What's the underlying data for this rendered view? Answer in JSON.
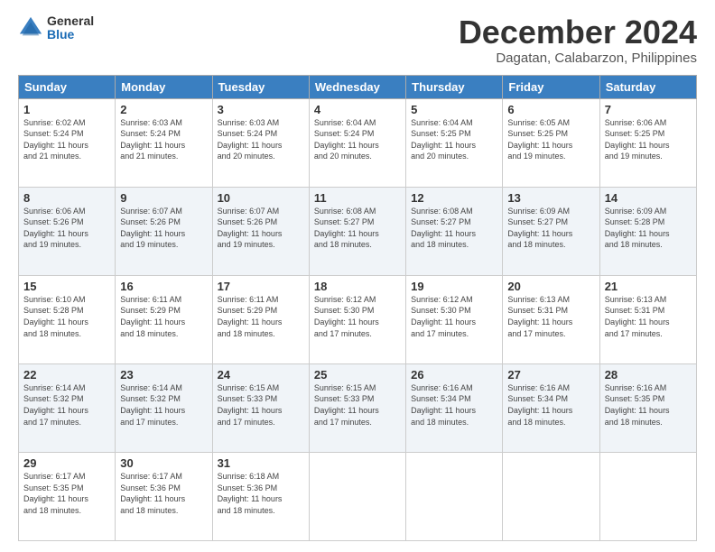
{
  "header": {
    "logo_general": "General",
    "logo_blue": "Blue",
    "month_title": "December 2024",
    "subtitle": "Dagatan, Calabarzon, Philippines"
  },
  "calendar": {
    "headers": [
      "Sunday",
      "Monday",
      "Tuesday",
      "Wednesday",
      "Thursday",
      "Friday",
      "Saturday"
    ],
    "weeks": [
      [
        {
          "day": "",
          "info": ""
        },
        {
          "day": "2",
          "info": "Sunrise: 6:03 AM\nSunset: 5:24 PM\nDaylight: 11 hours\nand 21 minutes."
        },
        {
          "day": "3",
          "info": "Sunrise: 6:03 AM\nSunset: 5:24 PM\nDaylight: 11 hours\nand 20 minutes."
        },
        {
          "day": "4",
          "info": "Sunrise: 6:04 AM\nSunset: 5:24 PM\nDaylight: 11 hours\nand 20 minutes."
        },
        {
          "day": "5",
          "info": "Sunrise: 6:04 AM\nSunset: 5:25 PM\nDaylight: 11 hours\nand 20 minutes."
        },
        {
          "day": "6",
          "info": "Sunrise: 6:05 AM\nSunset: 5:25 PM\nDaylight: 11 hours\nand 19 minutes."
        },
        {
          "day": "7",
          "info": "Sunrise: 6:06 AM\nSunset: 5:25 PM\nDaylight: 11 hours\nand 19 minutes."
        }
      ],
      [
        {
          "day": "1",
          "info": "Sunrise: 6:02 AM\nSunset: 5:24 PM\nDaylight: 11 hours\nand 21 minutes."
        },
        {
          "day": "",
          "info": ""
        },
        {
          "day": "",
          "info": ""
        },
        {
          "day": "",
          "info": ""
        },
        {
          "day": "",
          "info": ""
        },
        {
          "day": "",
          "info": ""
        },
        {
          "day": "",
          "info": ""
        }
      ],
      [
        {
          "day": "8",
          "info": "Sunrise: 6:06 AM\nSunset: 5:26 PM\nDaylight: 11 hours\nand 19 minutes."
        },
        {
          "day": "9",
          "info": "Sunrise: 6:07 AM\nSunset: 5:26 PM\nDaylight: 11 hours\nand 19 minutes."
        },
        {
          "day": "10",
          "info": "Sunrise: 6:07 AM\nSunset: 5:26 PM\nDaylight: 11 hours\nand 19 minutes."
        },
        {
          "day": "11",
          "info": "Sunrise: 6:08 AM\nSunset: 5:27 PM\nDaylight: 11 hours\nand 18 minutes."
        },
        {
          "day": "12",
          "info": "Sunrise: 6:08 AM\nSunset: 5:27 PM\nDaylight: 11 hours\nand 18 minutes."
        },
        {
          "day": "13",
          "info": "Sunrise: 6:09 AM\nSunset: 5:27 PM\nDaylight: 11 hours\nand 18 minutes."
        },
        {
          "day": "14",
          "info": "Sunrise: 6:09 AM\nSunset: 5:28 PM\nDaylight: 11 hours\nand 18 minutes."
        }
      ],
      [
        {
          "day": "15",
          "info": "Sunrise: 6:10 AM\nSunset: 5:28 PM\nDaylight: 11 hours\nand 18 minutes."
        },
        {
          "day": "16",
          "info": "Sunrise: 6:11 AM\nSunset: 5:29 PM\nDaylight: 11 hours\nand 18 minutes."
        },
        {
          "day": "17",
          "info": "Sunrise: 6:11 AM\nSunset: 5:29 PM\nDaylight: 11 hours\nand 18 minutes."
        },
        {
          "day": "18",
          "info": "Sunrise: 6:12 AM\nSunset: 5:30 PM\nDaylight: 11 hours\nand 17 minutes."
        },
        {
          "day": "19",
          "info": "Sunrise: 6:12 AM\nSunset: 5:30 PM\nDaylight: 11 hours\nand 17 minutes."
        },
        {
          "day": "20",
          "info": "Sunrise: 6:13 AM\nSunset: 5:31 PM\nDaylight: 11 hours\nand 17 minutes."
        },
        {
          "day": "21",
          "info": "Sunrise: 6:13 AM\nSunset: 5:31 PM\nDaylight: 11 hours\nand 17 minutes."
        }
      ],
      [
        {
          "day": "22",
          "info": "Sunrise: 6:14 AM\nSunset: 5:32 PM\nDaylight: 11 hours\nand 17 minutes."
        },
        {
          "day": "23",
          "info": "Sunrise: 6:14 AM\nSunset: 5:32 PM\nDaylight: 11 hours\nand 17 minutes."
        },
        {
          "day": "24",
          "info": "Sunrise: 6:15 AM\nSunset: 5:33 PM\nDaylight: 11 hours\nand 17 minutes."
        },
        {
          "day": "25",
          "info": "Sunrise: 6:15 AM\nSunset: 5:33 PM\nDaylight: 11 hours\nand 17 minutes."
        },
        {
          "day": "26",
          "info": "Sunrise: 6:16 AM\nSunset: 5:34 PM\nDaylight: 11 hours\nand 18 minutes."
        },
        {
          "day": "27",
          "info": "Sunrise: 6:16 AM\nSunset: 5:34 PM\nDaylight: 11 hours\nand 18 minutes."
        },
        {
          "day": "28",
          "info": "Sunrise: 6:16 AM\nSunset: 5:35 PM\nDaylight: 11 hours\nand 18 minutes."
        }
      ],
      [
        {
          "day": "29",
          "info": "Sunrise: 6:17 AM\nSunset: 5:35 PM\nDaylight: 11 hours\nand 18 minutes."
        },
        {
          "day": "30",
          "info": "Sunrise: 6:17 AM\nSunset: 5:36 PM\nDaylight: 11 hours\nand 18 minutes."
        },
        {
          "day": "31",
          "info": "Sunrise: 6:18 AM\nSunset: 5:36 PM\nDaylight: 11 hours\nand 18 minutes."
        },
        {
          "day": "",
          "info": ""
        },
        {
          "day": "",
          "info": ""
        },
        {
          "day": "",
          "info": ""
        },
        {
          "day": "",
          "info": ""
        }
      ]
    ]
  }
}
